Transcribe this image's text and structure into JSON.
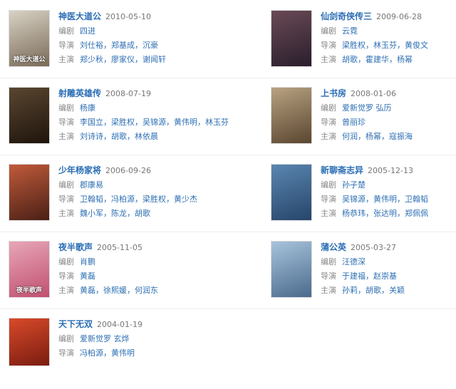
{
  "labels": {
    "writer": "编剧",
    "director": "导演",
    "cast": "主演"
  },
  "works": [
    {
      "title": "神医大道公",
      "date": "2010-05-10",
      "writer": "四进",
      "director": "刘仕裕，郑基成，沉豪",
      "cast": "郑少秋，廖家仪，谢闻轩",
      "poster_text": "神医大道公",
      "poster_colors": [
        "#d8d2c4",
        "#7a6a58"
      ]
    },
    {
      "title": "仙剑奇侠传三",
      "date": "2009-06-28",
      "writer": "云霓",
      "director": "梁胜权，林玉芬，黄俊文",
      "cast": "胡歌，霍建华，杨幂",
      "poster_text": "",
      "poster_colors": [
        "#6a4a56",
        "#2a1e2c"
      ]
    },
    {
      "title": "射雕英雄传",
      "date": "2008-07-19",
      "writer": "杨康",
      "director": "李国立，梁胜权，吴锦源，黄伟明，林玉芬",
      "cast": "刘诗诗，胡歌，林依晨",
      "poster_text": "",
      "poster_colors": [
        "#5a4630",
        "#1e140c"
      ]
    },
    {
      "title": "上书房",
      "date": "2008-01-06",
      "writer": "爱新觉罗 弘历",
      "director": "曾丽珍",
      "cast": "何润，杨幂，寇振海",
      "poster_text": "",
      "poster_colors": [
        "#b8a282",
        "#5a4630"
      ]
    },
    {
      "title": "少年杨家将",
      "date": "2006-09-26",
      "writer": "郡康易",
      "director": "卫翰韬，冯柏源，梁胜权，黄少杰",
      "cast": "魏小军，陈龙，胡歌",
      "poster_text": "",
      "poster_colors": [
        "#c05a3a",
        "#4a2016"
      ]
    },
    {
      "title": "新聊斋志异",
      "date": "2005-12-13",
      "writer": "孙子楚",
      "director": "吴锦源，黄伟明，卫翰韬",
      "cast": "杨恭玮，张达明，郑佩佩",
      "poster_text": "",
      "poster_colors": [
        "#5a86b0",
        "#27456a"
      ]
    },
    {
      "title": "夜半歌声",
      "date": "2005-11-05",
      "writer": "肖鹏",
      "director": "黄磊",
      "cast": "黄磊，徐熙媛，何润东",
      "poster_text": "夜半歌声",
      "poster_colors": [
        "#e8a6b8",
        "#c05070"
      ]
    },
    {
      "title": "蒲公英",
      "date": "2005-03-27",
      "writer": "汪德深",
      "director": "于建福，赵崇基",
      "cast": "孙莉，胡歌，关颖",
      "poster_text": "",
      "poster_colors": [
        "#a8c4dc",
        "#4a6a8c"
      ]
    },
    {
      "title": "天下无双",
      "date": "2004-01-19",
      "writer": "爱新觉罗 玄烨",
      "director": "冯柏源，黄伟明",
      "cast": "",
      "poster_text": "",
      "poster_colors": [
        "#d84a2a",
        "#7a1c10"
      ]
    }
  ]
}
